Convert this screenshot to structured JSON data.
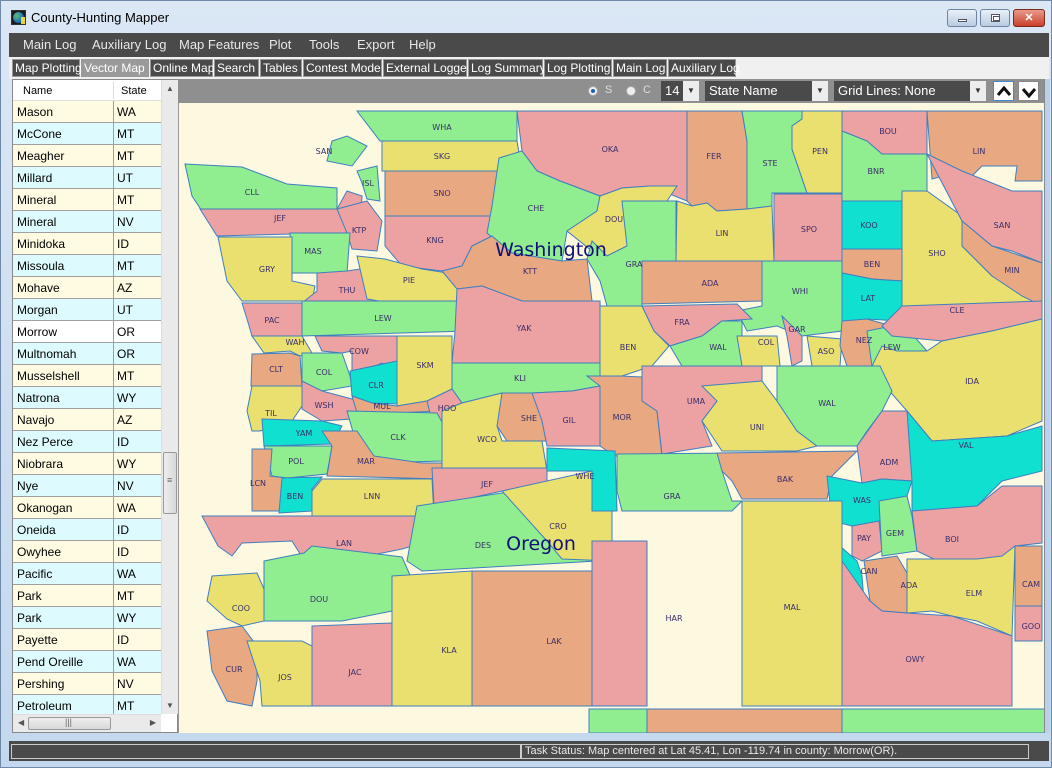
{
  "window": {
    "title": "County-Hunting Mapper",
    "controls": [
      "minimize",
      "maximize",
      "close"
    ]
  },
  "menu": [
    "Main Log",
    "Auxiliary Log",
    "Map Features",
    "Plot",
    "Tools",
    "Export",
    "Help"
  ],
  "tabs": [
    {
      "label": "Map Plotting",
      "active": false
    },
    {
      "label": "Vector Map",
      "active": true
    },
    {
      "label": "Online Map",
      "active": false
    },
    {
      "label": "Search",
      "active": false
    },
    {
      "label": "Tables",
      "active": false
    },
    {
      "label": "Contest Mode",
      "active": false
    },
    {
      "label": "External Logger",
      "active": false
    },
    {
      "label": "Log Summary",
      "active": false
    },
    {
      "label": "Log Plotting",
      "active": false
    },
    {
      "label": "Main Log",
      "active": false
    },
    {
      "label": "Auxiliary Log",
      "active": false
    }
  ],
  "county_grid": {
    "columns": [
      "Name",
      "State"
    ],
    "rows": [
      {
        "name": "Mason",
        "state": "WA"
      },
      {
        "name": "McCone",
        "state": "MT"
      },
      {
        "name": "Meagher",
        "state": "MT"
      },
      {
        "name": "Millard",
        "state": "UT"
      },
      {
        "name": "Mineral",
        "state": "MT"
      },
      {
        "name": "Mineral",
        "state": "NV"
      },
      {
        "name": "Minidoka",
        "state": "ID"
      },
      {
        "name": "Missoula",
        "state": "MT"
      },
      {
        "name": "Mohave",
        "state": "AZ"
      },
      {
        "name": "Morgan",
        "state": "UT"
      },
      {
        "name": "Morrow",
        "state": "OR",
        "selected": true
      },
      {
        "name": "Multnomah",
        "state": "OR"
      },
      {
        "name": "Musselshell",
        "state": "MT"
      },
      {
        "name": "Natrona",
        "state": "WY"
      },
      {
        "name": "Navajo",
        "state": "AZ"
      },
      {
        "name": "Nez Perce",
        "state": "ID"
      },
      {
        "name": "Niobrara",
        "state": "WY"
      },
      {
        "name": "Nye",
        "state": "NV"
      },
      {
        "name": "Okanogan",
        "state": "WA"
      },
      {
        "name": "Oneida",
        "state": "ID"
      },
      {
        "name": "Owyhee",
        "state": "ID"
      },
      {
        "name": "Pacific",
        "state": "WA"
      },
      {
        "name": "Park",
        "state": "MT"
      },
      {
        "name": "Park",
        "state": "WY"
      },
      {
        "name": "Payette",
        "state": "ID"
      },
      {
        "name": "Pend Oreille",
        "state": "WA"
      },
      {
        "name": "Pershing",
        "state": "NV"
      },
      {
        "name": "Petroleum",
        "state": "MT"
      }
    ]
  },
  "map_toolbar": {
    "radio_s": "S",
    "radio_c": "C",
    "selected_radio": "S",
    "font_size": "14",
    "label_mode": "State Name",
    "grid_lines": "Grid Lines: None"
  },
  "map": {
    "background": "#fdf8e0",
    "palette": {
      "green": "#90ee90",
      "yellow": "#eae070",
      "orange": "#e8a882",
      "pink": "#eca2a2",
      "cyan": "#10e0d0"
    },
    "state_labels": [
      "Washington",
      "Oregon"
    ],
    "counties": [
      {
        "abbr": "WHA",
        "color": "green"
      },
      {
        "abbr": "SKG",
        "color": "yellow"
      },
      {
        "abbr": "SAN",
        "color": "green"
      },
      {
        "abbr": "ISL",
        "color": "green"
      },
      {
        "abbr": "SNO",
        "color": "orange"
      },
      {
        "abbr": "CLL",
        "color": "green"
      },
      {
        "abbr": "JEF",
        "color": "pink"
      },
      {
        "abbr": "KTP",
        "color": "pink"
      },
      {
        "abbr": "KNG",
        "color": "pink"
      },
      {
        "abbr": "MAS",
        "color": "green"
      },
      {
        "abbr": "GRY",
        "color": "yellow"
      },
      {
        "abbr": "THU",
        "color": "pink"
      },
      {
        "abbr": "PIE",
        "color": "yellow"
      },
      {
        "abbr": "OKA",
        "color": "pink"
      },
      {
        "abbr": "CHE",
        "color": "green"
      },
      {
        "abbr": "DOU",
        "color": "yellow"
      },
      {
        "abbr": "KTT",
        "color": "orange"
      },
      {
        "abbr": "FER",
        "color": "orange"
      },
      {
        "abbr": "STE",
        "color": "green"
      },
      {
        "abbr": "PEN",
        "color": "yellow"
      },
      {
        "abbr": "LIN",
        "color": "yellow"
      },
      {
        "abbr": "SPO",
        "color": "pink"
      },
      {
        "abbr": "GRA",
        "color": "green"
      },
      {
        "abbr": "ADA",
        "color": "orange"
      },
      {
        "abbr": "WHI",
        "color": "green"
      },
      {
        "abbr": "PAC",
        "color": "pink"
      },
      {
        "abbr": "LEW",
        "color": "green"
      },
      {
        "abbr": "YAK",
        "color": "pink"
      },
      {
        "abbr": "WAH",
        "color": "yellow"
      },
      {
        "abbr": "COW",
        "color": "pink"
      },
      {
        "abbr": "SKM",
        "color": "yellow"
      },
      {
        "abbr": "CLT",
        "color": "orange"
      },
      {
        "abbr": "COL",
        "color": "green"
      },
      {
        "abbr": "CLR",
        "color": "cyan"
      },
      {
        "abbr": "KLI",
        "color": "green"
      },
      {
        "abbr": "BEN",
        "color": "yellow"
      },
      {
        "abbr": "FRA",
        "color": "pink"
      },
      {
        "abbr": "WAL",
        "color": "green"
      },
      {
        "abbr": "COL",
        "color": "yellow"
      },
      {
        "abbr": "GAR",
        "color": "pink"
      },
      {
        "abbr": "ASO",
        "color": "yellow"
      },
      {
        "abbr": "BOU",
        "color": "pink"
      },
      {
        "abbr": "BNR",
        "color": "green"
      },
      {
        "abbr": "KOO",
        "color": "cyan"
      },
      {
        "abbr": "BEN",
        "color": "orange"
      },
      {
        "abbr": "LAT",
        "color": "cyan"
      },
      {
        "abbr": "NEZ",
        "color": "orange"
      },
      {
        "abbr": "LEW",
        "color": "green"
      },
      {
        "abbr": "LIN",
        "color": "orange"
      },
      {
        "abbr": "SHO",
        "color": "yellow"
      },
      {
        "abbr": "SAN",
        "color": "pink"
      },
      {
        "abbr": "MIN",
        "color": "orange"
      },
      {
        "abbr": "CLE",
        "color": "pink"
      },
      {
        "abbr": "IDA",
        "color": "yellow"
      },
      {
        "abbr": "TIL",
        "color": "yellow"
      },
      {
        "abbr": "WSH",
        "color": "pink"
      },
      {
        "abbr": "MUL",
        "color": "orange"
      },
      {
        "abbr": "HOO",
        "color": "pink"
      },
      {
        "abbr": "YAM",
        "color": "cyan"
      },
      {
        "abbr": "CLK",
        "color": "green"
      },
      {
        "abbr": "WCO",
        "color": "yellow"
      },
      {
        "abbr": "SHE",
        "color": "orange"
      },
      {
        "abbr": "GIL",
        "color": "pink"
      },
      {
        "abbr": "MOR",
        "color": "orange"
      },
      {
        "abbr": "UMA",
        "color": "pink"
      },
      {
        "abbr": "UNI",
        "color": "yellow"
      },
      {
        "abbr": "WAL",
        "color": "green"
      },
      {
        "abbr": "POL",
        "color": "green"
      },
      {
        "abbr": "MAR",
        "color": "orange"
      },
      {
        "abbr": "LCN",
        "color": "orange"
      },
      {
        "abbr": "BEN",
        "color": "cyan"
      },
      {
        "abbr": "LNN",
        "color": "yellow"
      },
      {
        "abbr": "JEF",
        "color": "pink"
      },
      {
        "abbr": "WHE",
        "color": "cyan"
      },
      {
        "abbr": "GRA",
        "color": "green"
      },
      {
        "abbr": "BAK",
        "color": "orange"
      },
      {
        "abbr": "ADM",
        "color": "pink"
      },
      {
        "abbr": "VAL",
        "color": "cyan"
      },
      {
        "abbr": "WAS",
        "color": "cyan"
      },
      {
        "abbr": "LAN",
        "color": "pink"
      },
      {
        "abbr": "DES",
        "color": "green"
      },
      {
        "abbr": "CRO",
        "color": "yellow"
      },
      {
        "abbr": "PAY",
        "color": "pink"
      },
      {
        "abbr": "GEM",
        "color": "green"
      },
      {
        "abbr": "BOI",
        "color": "pink"
      },
      {
        "abbr": "CAN",
        "color": "cyan"
      },
      {
        "abbr": "COO",
        "color": "yellow"
      },
      {
        "abbr": "DOU",
        "color": "green"
      },
      {
        "abbr": "ADA",
        "color": "orange"
      },
      {
        "abbr": "ELM",
        "color": "yellow"
      },
      {
        "abbr": "CAM",
        "color": "orange"
      },
      {
        "abbr": "CUR",
        "color": "orange"
      },
      {
        "abbr": "JOS",
        "color": "yellow"
      },
      {
        "abbr": "JAC",
        "color": "pink"
      },
      {
        "abbr": "KLA",
        "color": "yellow"
      },
      {
        "abbr": "LAK",
        "color": "orange"
      },
      {
        "abbr": "HAR",
        "color": "pink"
      },
      {
        "abbr": "MAL",
        "color": "yellow"
      },
      {
        "abbr": "OWY",
        "color": "pink"
      },
      {
        "abbr": "GOO",
        "color": "pink"
      }
    ]
  },
  "status": {
    "left": "",
    "task": "Task Status: Map centered at Lat 45.41, Lon -119.74 in county: Morrow(OR)."
  }
}
